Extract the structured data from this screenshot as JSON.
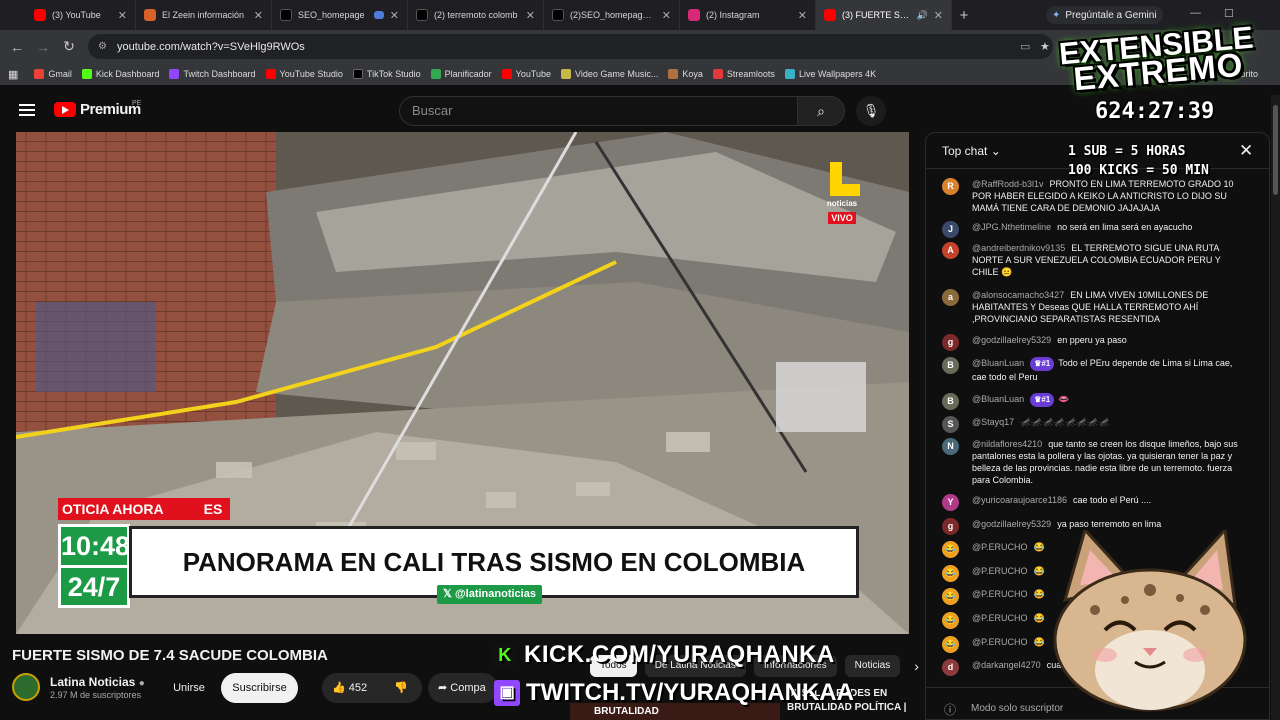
{
  "browser": {
    "tabs": [
      {
        "title": "(3) YouTube",
        "color": "#ff0000"
      },
      {
        "title": "El Zeein información",
        "color": "#d9622b"
      },
      {
        "title": "SEO_homepage",
        "color": "#000000"
      },
      {
        "title": "",
        "color": "#4f7bd9"
      },
      {
        "title": "(2) terremoto colomb",
        "color": "#000000"
      },
      {
        "title": "(2)SEO_homepage_ti",
        "color": "#000000"
      },
      {
        "title": "(2) Instagram",
        "color": "#d62976"
      },
      {
        "title": "(3) FUERTE SISMO",
        "color": "#ff0000"
      }
    ],
    "new_tab": "+",
    "gemini": "Pregúntale a Gemini",
    "url": "youtube.com/watch?v=SVeHlg9RWOs",
    "bookmarks": [
      {
        "label": "Gmail",
        "color": "#ea4335"
      },
      {
        "label": "Kick Dashboard",
        "color": "#53fc18"
      },
      {
        "label": "Twitch Dashboard",
        "color": "#9146ff"
      },
      {
        "label": "YouTube Studio",
        "color": "#ff0000"
      },
      {
        "label": "TikTok Studio",
        "color": "#000000"
      },
      {
        "label": "Planificador",
        "color": "#34a853"
      },
      {
        "label": "YouTube",
        "color": "#ff0000"
      },
      {
        "label": "Video Game Music...",
        "color": "#c7b84a"
      },
      {
        "label": "Koya",
        "color": "#b07040"
      },
      {
        "label": "Streamloots",
        "color": "#e03a3a"
      },
      {
        "label": "Live Wallpapers 4K",
        "color": "#3ab0c7"
      },
      {
        "label": "vorito",
        "color": "#888888"
      }
    ]
  },
  "youtube": {
    "logo_word": "Premium",
    "region": "PE",
    "search_placeholder": "Buscar"
  },
  "video": {
    "channel_logo_text": "noticias",
    "live_label": "VIVO",
    "ticker_left": "OTICIA AHORA",
    "ticker_right": "ES",
    "clock_time": "10:48",
    "clock_247": "24/7",
    "headline": "PANORAMA EN CALI TRAS SISMO EN COLOMBIA",
    "handle": "@latinanoticias"
  },
  "below": {
    "title": "FUERTE SISMO DE 7.4 SACUDE COLOMBIA",
    "channel": "Latina Noticias",
    "subs": "2.97 M de suscriptores",
    "join": "Unirse",
    "subscribe": "Suscribirse",
    "likes": "452",
    "share": "Compa",
    "chips": [
      "Todos",
      "De Latina Noticias",
      "Informaciones",
      "Noticias"
    ],
    "related_title_1": "SUSEL PAREDES EN",
    "related_title_2": "BRUTALIDAD POLÍTICA |",
    "thumb_text": "BRUTALIDAD"
  },
  "overlay": {
    "brand_line1": "EXTENSIBLE",
    "brand_line2": "EXTREMO",
    "timer": "624:27:39",
    "rule1": "1 SUB = 5 HORAS",
    "rule2": "100 KICKS = 50 MIN",
    "kick_url": "KICK.COM/YURAQHANKA",
    "twitch_url": "TWITCH.TV/YURAQHANKAA"
  },
  "chat": {
    "header": "Top chat",
    "footer": "Modo solo suscriptor",
    "messages": [
      {
        "initial": "R",
        "color": "#d9822b",
        "author": "@RaffRodd-b3l1v",
        "text": "PRONTO EN LIMA TERREMOTO GRADO 10 POR HABER ELEGIDO A KEIKO LA ANTICRISTO LO DIJO SU MAMÁ TIENE CARA DE DEMONIO JAJAJAJA"
      },
      {
        "initial": "J",
        "color": "#3b4a6b",
        "author": "@JPG.Nthetimeline",
        "text": "no será en lima será en ayacucho"
      },
      {
        "initial": "A",
        "color": "#c4442b",
        "author": "@andreiberdnikov9135",
        "text": "EL TERREMOTO SIGUE UNA RUTA NORTE A SUR VENEZUELA COLOMBIA ECUADOR PERU Y CHILE 😐"
      },
      {
        "initial": "a",
        "color": "#8a6a3a",
        "author": "@alonsocamacho3427",
        "text": "EN LIMA VIVEN 10MILLONES DE HABITANTES Y Deseas QUE HALLA TERREMOTO AHÍ ,PROVINCIANO SEPARATISTAS RESENTIDA"
      },
      {
        "initial": "g",
        "color": "#7a2a2a",
        "author": "@godzillaelrey5329",
        "text": "en pperu ya paso"
      },
      {
        "initial": "B",
        "color": "#6a6a5a",
        "author": "@BluanLuan",
        "badge": "♛#1",
        "text": "Todo el PEru depende de Lima si Lima cae, cae todo el Peru"
      },
      {
        "initial": "B",
        "color": "#6a6a5a",
        "author": "@BluanLuan",
        "badge": "♛#1",
        "text": "👄"
      },
      {
        "initial": "S",
        "color": "#555555",
        "author": "@Stayq17",
        "text": "🦟🦟🦟🦟🦟🦟🦟🦟"
      },
      {
        "initial": "N",
        "color": "#4a6a7a",
        "author": "@nildaflores4210",
        "text": "que tanto se creen los disque limeños, bajo sus pantalones esta la pollera y las ojotas. ya quisieran tener la paz y belleza de las provincias. nadie esta libre de un terremoto. fuerza para Colombia."
      },
      {
        "initial": "Y",
        "color": "#b03a8a",
        "author": "@yuricoaraujoarce1186",
        "text": "cae todo el Perú ...."
      },
      {
        "initial": "g",
        "color": "#7a2a2a",
        "author": "@godzillaelrey5329",
        "text": "ya paso terremoto en lima"
      },
      {
        "initial": "😂",
        "color": "#f0a020",
        "author": "@P.ERUCHO",
        "text": "😂"
      },
      {
        "initial": "😂",
        "color": "#f0a020",
        "author": "@P.ERUCHO",
        "text": "😂"
      },
      {
        "initial": "😂",
        "color": "#f0a020",
        "author": "@P.ERUCHO",
        "text": "😂"
      },
      {
        "initial": "😂",
        "color": "#f0a020",
        "author": "@P.ERUCHO",
        "text": "😂"
      },
      {
        "initial": "😂",
        "color": "#f0a020",
        "author": "@P.ERUCHO",
        "text": "😂"
      },
      {
        "initial": "d",
        "color": "#8a3a3a",
        "author": "@darkangel4270",
        "text": "cuan"
      }
    ]
  }
}
